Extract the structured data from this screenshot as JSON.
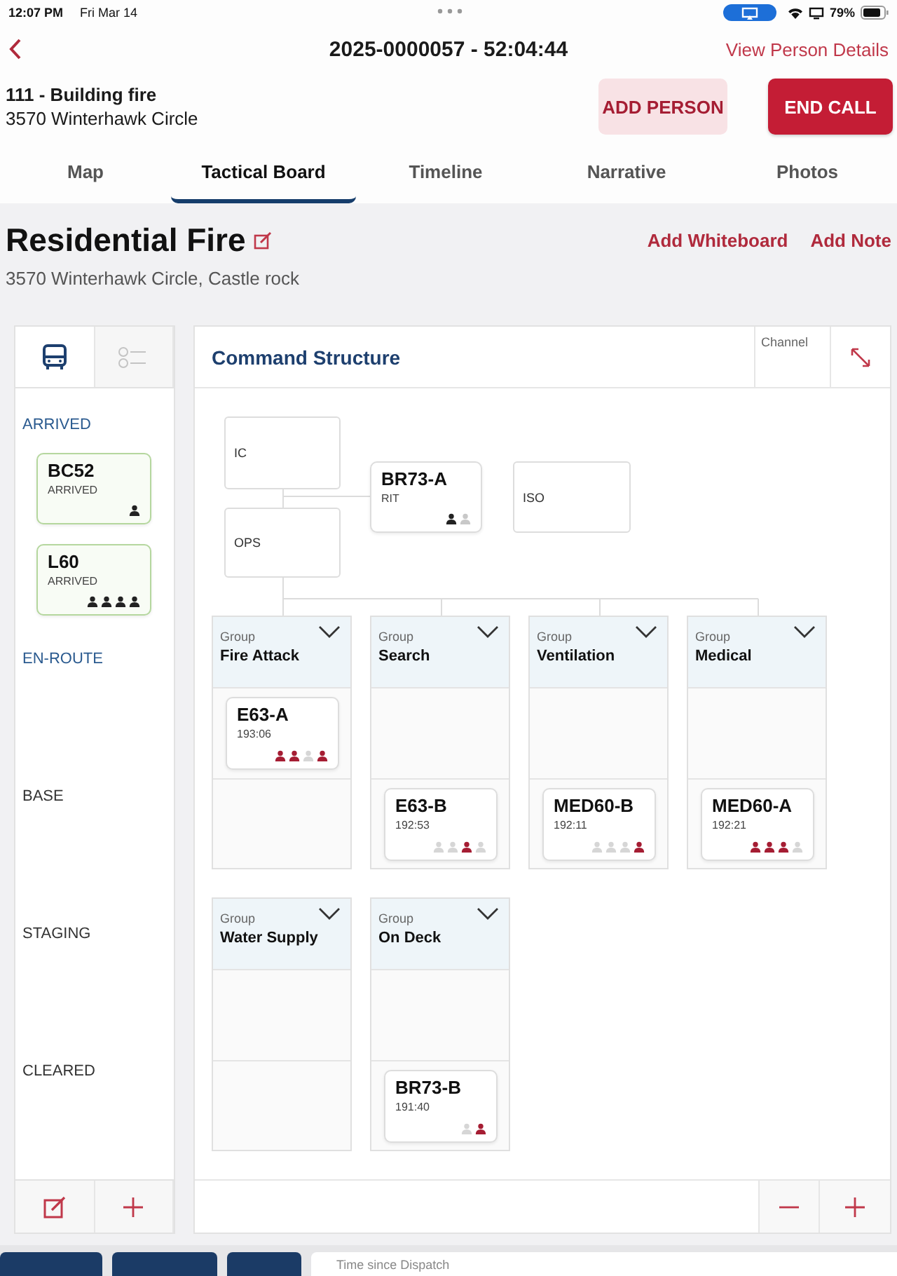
{
  "status_bar": {
    "time": "12:07 PM",
    "date": "Fri Mar 14",
    "battery": "79%"
  },
  "nav": {
    "title": "2025-0000057 - 52:04:44",
    "link": "View Person Details"
  },
  "incident": {
    "type": "111 - Building fire",
    "address": "3570 Winterhawk Circle",
    "buttons": [
      {
        "label": "ADD PERSON",
        "kind": "secondary"
      },
      {
        "label": "END CALL",
        "kind": "primary"
      }
    ]
  },
  "tabs": [
    {
      "label": "Map",
      "selected": false
    },
    {
      "label": "Tactical Board",
      "selected": true
    },
    {
      "label": "Timeline",
      "selected": false
    },
    {
      "label": "Narrative",
      "selected": false
    },
    {
      "label": "Photos",
      "selected": false
    }
  ],
  "board": {
    "title": "Residential Fire",
    "address": "3570 Winterhawk Circle, Castle rock",
    "actions": [
      "Add Whiteboard",
      "Add Note"
    ]
  },
  "sidebar": {
    "views": [
      {
        "kind": "units",
        "selected": true
      },
      {
        "kind": "checklist",
        "selected": false
      }
    ],
    "sections": [
      {
        "label": "ARRIVED",
        "highlighted": true,
        "units": [
          {
            "name": "BC52",
            "status": "ARRIVED",
            "crew": [
              {
                "active": true
              }
            ]
          },
          {
            "name": "L60",
            "status": "ARRIVED",
            "crew": [
              {
                "active": true
              },
              {
                "active": true
              },
              {
                "active": true
              },
              {
                "active": true
              }
            ]
          }
        ]
      },
      {
        "label": "EN-ROUTE",
        "highlighted": true
      },
      {
        "label": "BASE",
        "highlighted": false
      },
      {
        "label": "STAGING",
        "highlighted": false
      },
      {
        "label": "CLEARED",
        "highlighted": false
      }
    ]
  },
  "command": {
    "title": "Command Structure",
    "channel": "Channel",
    "positions": [
      {
        "kind": "role",
        "label": "IC"
      },
      {
        "kind": "role",
        "label": "OPS"
      },
      {
        "kind": "unit",
        "name": "BR73-A",
        "status": "RIT",
        "crew": [
          {
            "active": true
          },
          {
            "active": false
          }
        ]
      },
      {
        "kind": "role",
        "label": "ISO"
      }
    ],
    "groups": [
      {
        "caption": "Group",
        "name": "Fire Attack",
        "slots": [
          {
            "kind": "unit",
            "name": "E63-A",
            "status": "193:06",
            "crew": [
              {
                "active": true
              },
              {
                "active": true
              },
              {
                "active": false
              },
              {
                "active": true
              }
            ]
          },
          {
            "kind": "empty"
          }
        ]
      },
      {
        "caption": "Group",
        "name": "Search",
        "slots": [
          {
            "kind": "empty"
          },
          {
            "kind": "unit",
            "name": "E63-B",
            "status": "192:53",
            "crew": [
              {
                "active": false
              },
              {
                "active": false
              },
              {
                "active": true
              },
              {
                "active": false
              }
            ]
          }
        ]
      },
      {
        "caption": "Group",
        "name": "Ventilation",
        "slots": [
          {
            "kind": "empty"
          },
          {
            "kind": "unit",
            "name": "MED60-B",
            "status": "192:11",
            "crew": [
              {
                "active": false
              },
              {
                "active": false
              },
              {
                "active": false
              },
              {
                "active": true
              }
            ]
          }
        ]
      },
      {
        "caption": "Group",
        "name": "Medical",
        "slots": [
          {
            "kind": "empty"
          },
          {
            "kind": "unit",
            "name": "MED60-A",
            "status": "192:21",
            "crew": [
              {
                "active": true
              },
              {
                "active": true
              },
              {
                "active": true
              },
              {
                "active": false
              }
            ]
          }
        ]
      },
      {
        "caption": "Group",
        "name": "Water Supply",
        "slots": [
          {
            "kind": "empty"
          },
          {
            "kind": "empty"
          }
        ]
      },
      {
        "caption": "Group",
        "name": "On Deck",
        "slots": [
          {
            "kind": "empty"
          },
          {
            "kind": "unit",
            "name": "BR73-B",
            "status": "191:40",
            "crew": [
              {
                "active": false
              },
              {
                "active": true
              }
            ]
          }
        ]
      }
    ]
  },
  "footer": {
    "field_label": "Time since Dispatch"
  }
}
